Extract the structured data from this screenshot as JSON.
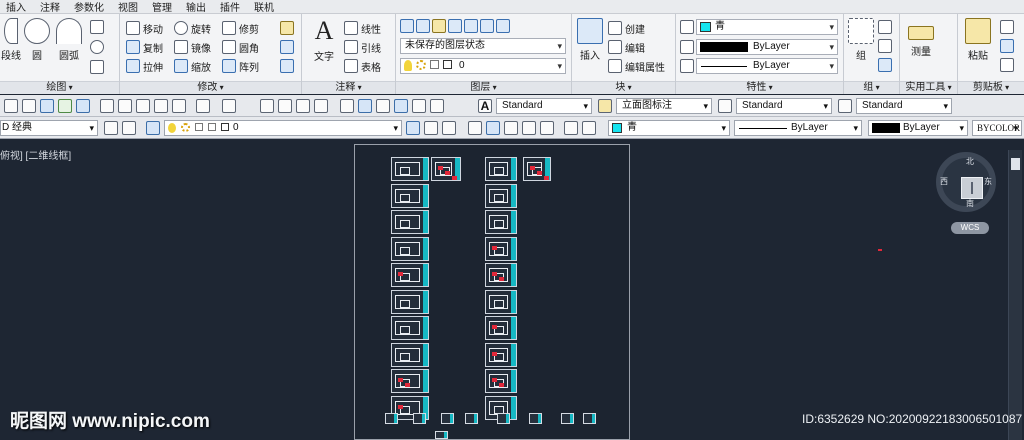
{
  "menu": [
    "插入",
    "注释",
    "参数化",
    "视图",
    "管理",
    "输出",
    "插件",
    "联机"
  ],
  "ribbon": {
    "draw": {
      "title": "绘图",
      "items": [
        "段线",
        "圆",
        "圆弧"
      ]
    },
    "modify": {
      "title": "修改",
      "items": [
        "移动",
        "旋转",
        "修剪",
        "复制",
        "镜像",
        "圆角",
        "拉伸",
        "缩放",
        "阵列"
      ]
    },
    "annotation": {
      "title": "注释",
      "text": "文字",
      "linear": "线性",
      "leader": "引线",
      "table": "表格"
    },
    "layers": {
      "title": "图层",
      "layer_state": "未保存的图层状态",
      "layer_current": "0"
    },
    "block": {
      "title": "块",
      "insert": "插入",
      "create": "创建",
      "edit": "编辑",
      "edit_attr": "编辑属性"
    },
    "properties": {
      "title": "特性",
      "color": "青",
      "lineweight": "ByLayer",
      "linetype": "ByLayer"
    },
    "group": {
      "title": "组",
      "label": "组"
    },
    "utilities": {
      "title": "实用工具",
      "measure": "测量"
    },
    "clipboard": {
      "title": "剪贴板",
      "paste": "粘贴"
    }
  },
  "toolbar1": {
    "text_style": "Standard",
    "dim_style": "立面图标注",
    "table_style": "Standard",
    "mleader_style": "Standard"
  },
  "toolbar2": {
    "workspace": "D 经典",
    "layer": "0",
    "color": "青",
    "linetype": "ByLayer",
    "lineweight": "ByLayer",
    "plotstyle": "BYCOLOR"
  },
  "viewport": {
    "label": "俯视] [二维线框]",
    "compass": {
      "north": "北",
      "south": "南",
      "east": "东",
      "west": "西",
      "wcs": "WCS"
    }
  },
  "watermark": "昵图网 www.nipic.com",
  "image_id": "ID:6352629 NO:20200922183006501087",
  "colors": {
    "accent_cyan": "#16b8c4",
    "red_mark": "#e2283a",
    "canvas": "#1e2633"
  }
}
